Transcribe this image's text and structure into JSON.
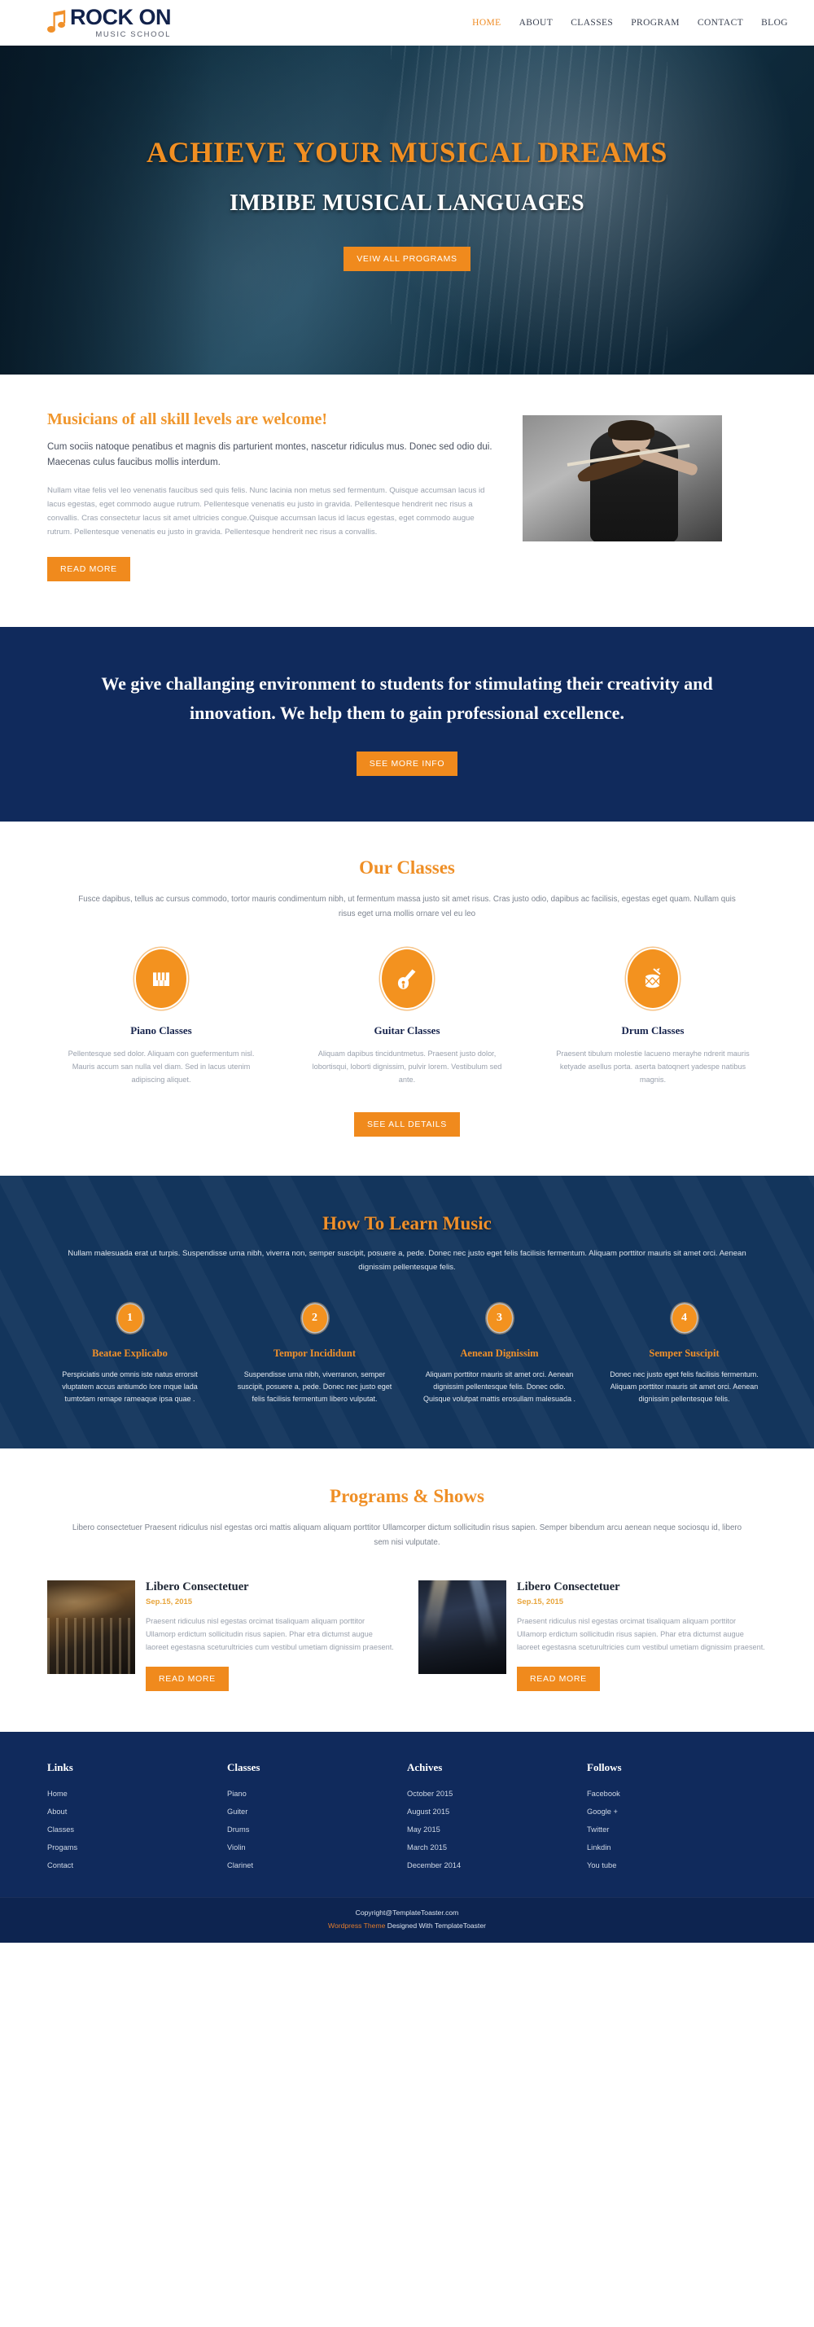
{
  "header": {
    "logo_title": "ROCK ON",
    "logo_sub": "MUSIC SCHOOL",
    "logo_icon": "music-note-icon",
    "nav": [
      {
        "label": "HOME",
        "active": true
      },
      {
        "label": "ABOUT",
        "active": false
      },
      {
        "label": "CLASSES",
        "active": false
      },
      {
        "label": "PROGRAM",
        "active": false
      },
      {
        "label": "CONTACT",
        "active": false
      },
      {
        "label": "BLOG",
        "active": false
      }
    ]
  },
  "hero": {
    "headline": "ACHIEVE YOUR MUSICAL DREAMS",
    "subheadline": "IMBIBE MUSICAL LANGUAGES",
    "button": "VEIW ALL PROGRAMS"
  },
  "about": {
    "heading": "Musicians of all skill levels are welcome!",
    "lead": "Cum sociis natoque penatibus et magnis dis parturient montes, nascetur ridiculus mus. Donec sed odio dui. Maecenas culus faucibus mollis interdum.",
    "body": "Nullam vitae felis vel leo venenatis faucibus sed quis felis. Nunc lacinia non metus sed fermentum. Quisque accumsan lacus id lacus egestas, eget commodo augue rutrum. Pellentesque venenatis eu justo in gravida. Pellentesque hendrerit nec risus a convallis. Cras consectetur lacus sit amet ultricies congue.Quisque accumsan lacus id lacus egestas, eget commodo augue rutrum. Pellentesque venenatis eu justo in gravida. Pellentesque hendrerit nec risus a convallis.",
    "button": "READ MORE",
    "image_alt": "violin-player-photo"
  },
  "cta": {
    "text": "We give challanging environment to students for stimulating their creativity and innovation. We help them to gain professional excellence.",
    "button": "SEE MORE INFO"
  },
  "classes": {
    "title": "Our Classes",
    "subtitle": "Fusce dapibus, tellus ac cursus commodo, tortor mauris condimentum nibh, ut fermentum massa justo sit amet risus. Cras justo odio, dapibus ac facilisis, egestas eget quam. Nullam quis risus eget urna mollis ornare vel eu leo",
    "items": [
      {
        "icon": "piano-icon",
        "name": "Piano Classes",
        "desc": "Pellentesque sed dolor. Aliquam con guefermentum nisl. Mauris accum san nulla vel diam. Sed in lacus utenim adipiscing aliquet."
      },
      {
        "icon": "guitar-icon",
        "name": "Guitar Classes",
        "desc": "Aliquam dapibus tinciduntmetus. Praesent justo dolor, lobortisqui, loborti dignissim, pulvir lorem. Vestibulum sed ante."
      },
      {
        "icon": "drum-icon",
        "name": "Drum Classes",
        "desc": "Praesent tibulum molestie lacueno merayhe ndrerit mauris ketyade asellus porta. aserta batoqnert yadespe natibus magnis."
      }
    ],
    "button": "SEE ALL DETAILS"
  },
  "howto": {
    "title": "How To Learn Music",
    "subtitle": "Nullam malesuada erat ut turpis. Suspendisse urna nibh, viverra non, semper suscipit, posuere a, pede. Donec nec justo eget felis facilisis fermentum. Aliquam porttitor mauris sit amet orci. Aenean dignissim pellentesque felis.",
    "steps": [
      {
        "num": "1",
        "title": "Beatae Explicabo",
        "desc": "Perspiciatis unde omnis iste natus errorsit vluptatem accus antiumdo lore mque lada tumtotam remape rameaque ipsa quae ."
      },
      {
        "num": "2",
        "title": "Tempor Incididunt",
        "desc": "Suspendisse urna nibh, viverranon, semper suscipit, posuere a, pede. Donec nec justo eget felis facilisis fermentum libero vulputat."
      },
      {
        "num": "3",
        "title": "Aenean Dignissim",
        "desc": "Aliquam porttitor mauris sit amet orci. Aenean dignissim pellentesque felis. Donec odio. Quisque volutpat mattis erosullam malesuada ."
      },
      {
        "num": "4",
        "title": "Semper Suscipit",
        "desc": "Donec nec justo eget felis facilisis fermentum. Aliquam porttitor mauris sit amet orci. Aenean dignissim pellentesque felis."
      }
    ]
  },
  "programs": {
    "title": "Programs & Shows",
    "subtitle": "Libero consectetuer Praesent ridiculus nisl egestas orci mattis aliquam aliquam porttitor Ullamcorper dictum sollicitudin risus sapien. Semper bibendum arcu aenean neque sociosqu id, libero sem nisi vulputate.",
    "cards": [
      {
        "image_alt": "orchestra-photo",
        "title": "Libero Consectetuer",
        "date": "Sep.15, 2015",
        "text": "Praesent ridiculus nisl egestas orcimat tisaliquam aliquam porttitor Ullamorp erdictum sollicitudin risus sapien. Phar etra dictumst augue laoreet egestasna sceturultricies cum vestibul umetiam dignissim praesent.",
        "button": "READ MORE"
      },
      {
        "image_alt": "concert-stage-photo",
        "title": "Libero Consectetuer",
        "date": "Sep.15, 2015",
        "text": "Praesent ridiculus nisl egestas orcimat tisaliquam aliquam porttitor Ullamorp erdictum sollicitudin risus sapien. Phar etra dictumst augue laoreet egestasna sceturultricies cum vestibul umetiam dignissim praesent.",
        "button": "READ MORE"
      }
    ]
  },
  "footer": {
    "columns": [
      {
        "head": "Links",
        "links": [
          "Home",
          "About",
          "Classes",
          "Progams",
          "Contact"
        ]
      },
      {
        "head": "Classes",
        "links": [
          "Piano",
          "Guiter",
          "Drums",
          "Violin",
          "Clarinet"
        ]
      },
      {
        "head": "Achives",
        "links": [
          "October 2015",
          "August 2015",
          "May 2015",
          "March 2015",
          "December 2014"
        ]
      },
      {
        "head": "Follows",
        "links": [
          "Facebook",
          "Google +",
          "Twitter",
          "Linkdin",
          "You tube"
        ]
      }
    ],
    "copyright": "Copyright@TemplateToaster.com",
    "credit_prefix": "Wordpress Theme",
    "credit_rest": " Designed With TemplateToaster"
  },
  "colors": {
    "orange": "#f0902a",
    "navy": "#102a5c",
    "dark_text": "#17244d"
  }
}
